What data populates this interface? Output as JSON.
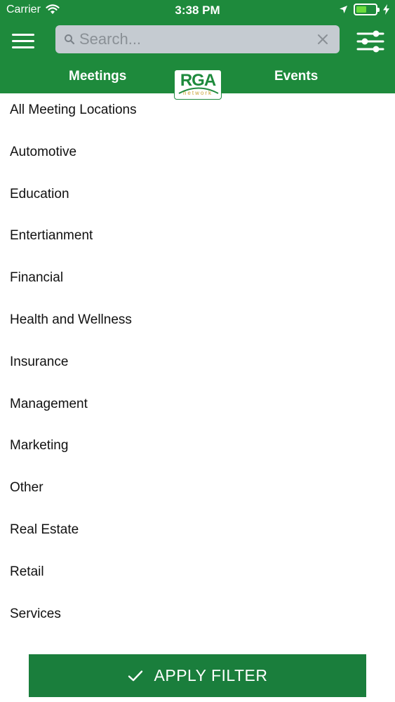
{
  "status_bar": {
    "carrier": "Carrier",
    "time": "3:38 PM",
    "battery_level": 0.55
  },
  "header": {
    "search_placeholder": "Search...",
    "tabs": [
      {
        "label": "Meetings"
      },
      {
        "label": "Events"
      }
    ],
    "logo_text": "RGA",
    "logo_subtext": "network"
  },
  "list": {
    "items": [
      {
        "label": "All Meeting Locations"
      },
      {
        "label": "Automotive"
      },
      {
        "label": "Education"
      },
      {
        "label": "Entertianment"
      },
      {
        "label": "Financial"
      },
      {
        "label": "Health and Wellness"
      },
      {
        "label": "Insurance"
      },
      {
        "label": "Management"
      },
      {
        "label": "Marketing"
      },
      {
        "label": "Other"
      },
      {
        "label": "Real Estate"
      },
      {
        "label": "Retail"
      },
      {
        "label": "Services"
      }
    ]
  },
  "apply_button": {
    "label": "APPLY FILTER"
  },
  "colors": {
    "brand_green": "#1e8a3c",
    "button_green": "#1a7e3c",
    "search_bg": "#c5cbd1"
  },
  "icons": {
    "menu": "hamburger-icon",
    "search": "magnifier-icon",
    "clear": "close-icon",
    "filter": "sliders-icon",
    "apply": "checkmark-icon"
  }
}
